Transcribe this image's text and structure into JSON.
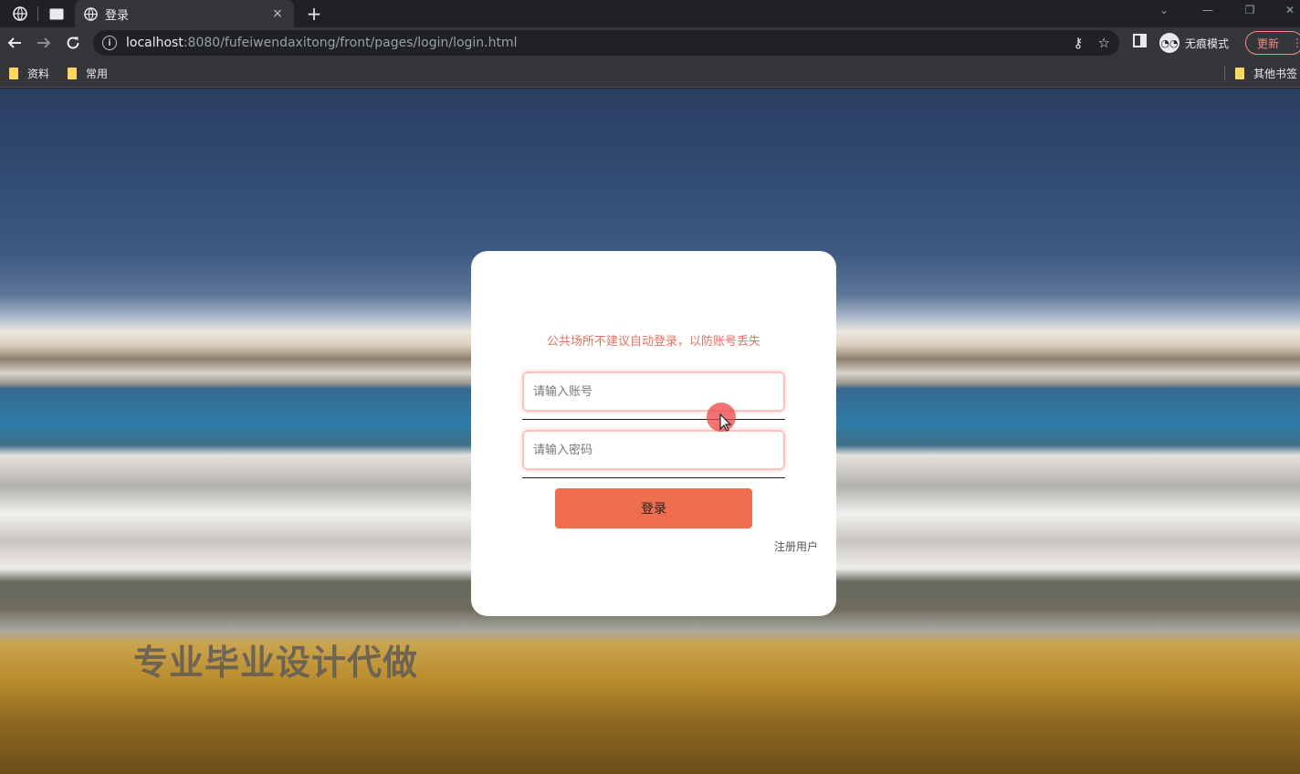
{
  "browser": {
    "tab": {
      "title": "登录",
      "close": "×",
      "new_tab": "+"
    },
    "url": {
      "host": "localhost",
      "rest": ":8080/fufeiwendaxitong/front/pages/login/login.html"
    },
    "incognito_label": "无痕模式",
    "update_label": "更新",
    "bookmarks": [
      {
        "label": "资料"
      },
      {
        "label": "常用"
      }
    ],
    "other_bookmarks": "其他书签"
  },
  "login": {
    "notice": "公共场所不建议自动登录，以防账号丢失",
    "username_placeholder": "请输入账号",
    "password_placeholder": "请输入密码",
    "login_button": "登录",
    "register_link": "注册用户"
  },
  "watermark": "专业毕业设计代做",
  "colors": {
    "accent": "#ef6e50",
    "notice": "#e57060",
    "card": "#ffffff"
  }
}
